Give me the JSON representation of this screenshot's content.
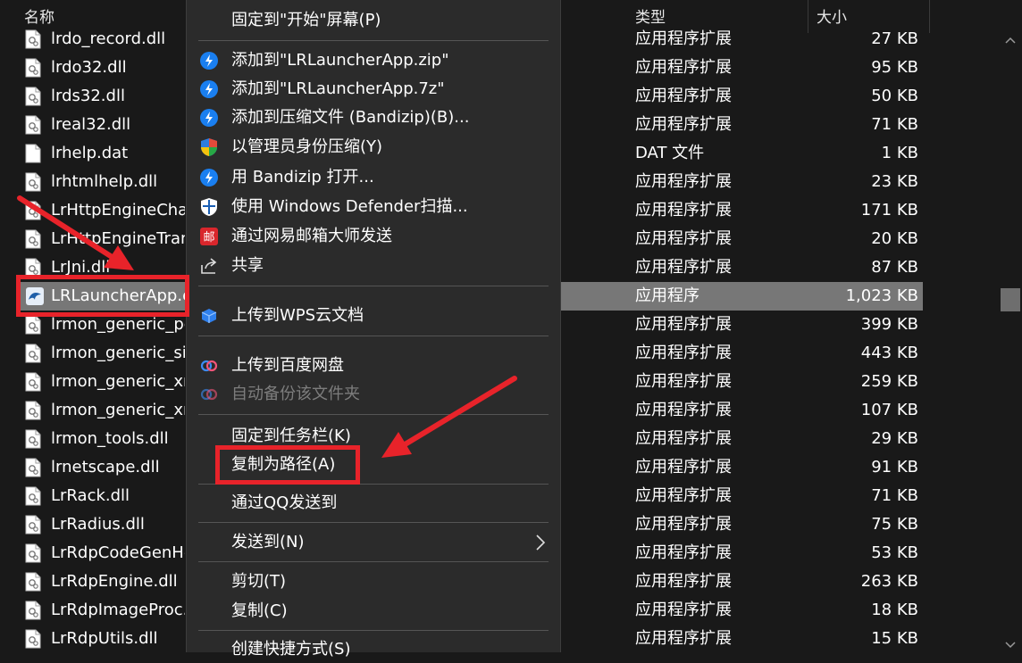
{
  "header": {
    "col_name": "名称",
    "col_type": "类型",
    "col_size": "大小"
  },
  "files": [
    {
      "name": "lrdo_record.dll",
      "type": "应用程序扩展",
      "size": "27 KB",
      "icon": "dll-icon"
    },
    {
      "name": "lrdo32.dll",
      "type": "应用程序扩展",
      "size": "95 KB",
      "icon": "dll-icon"
    },
    {
      "name": "lrds32.dll",
      "type": "应用程序扩展",
      "size": "50 KB",
      "icon": "dll-icon"
    },
    {
      "name": "lreal32.dll",
      "type": "应用程序扩展",
      "size": "71 KB",
      "icon": "dll-icon"
    },
    {
      "name": "lrhelp.dat",
      "type": "DAT 文件",
      "size": "1 KB",
      "icon": "file-icon"
    },
    {
      "name": "lrhtmlhelp.dll",
      "type": "应用程序扩展",
      "size": "23 KB",
      "icon": "dll-icon"
    },
    {
      "name": "LrHttpEngineChar",
      "type": "应用程序扩展",
      "size": "171 KB",
      "icon": "dll-icon"
    },
    {
      "name": "LrHttpEngineTran",
      "type": "应用程序扩展",
      "size": "20 KB",
      "icon": "dll-icon"
    },
    {
      "name": "LrJni.dll",
      "type": "应用程序扩展",
      "size": "87 KB",
      "icon": "dll-icon"
    },
    {
      "name": "LRLauncherApp.e",
      "type": "应用程序",
      "size": "1,023 KB",
      "icon": "app-icon",
      "selected": true
    },
    {
      "name": "lrmon_generic_pc",
      "type": "应用程序扩展",
      "size": "399 KB",
      "icon": "dll-icon"
    },
    {
      "name": "lrmon_generic_sit",
      "type": "应用程序扩展",
      "size": "443 KB",
      "icon": "dll-icon"
    },
    {
      "name": "lrmon_generic_xm",
      "type": "应用程序扩展",
      "size": "259 KB",
      "icon": "dll-icon"
    },
    {
      "name": "lrmon_generic_xm",
      "type": "应用程序扩展",
      "size": "107 KB",
      "icon": "dll-icon"
    },
    {
      "name": "lrmon_tools.dll",
      "type": "应用程序扩展",
      "size": "29 KB",
      "icon": "dll-icon"
    },
    {
      "name": "lrnetscape.dll",
      "type": "应用程序扩展",
      "size": "91 KB",
      "icon": "dll-icon"
    },
    {
      "name": "LrRack.dll",
      "type": "应用程序扩展",
      "size": "71 KB",
      "icon": "dll-icon"
    },
    {
      "name": "LrRadius.dll",
      "type": "应用程序扩展",
      "size": "75 KB",
      "icon": "dll-icon"
    },
    {
      "name": "LrRdpCodeGenHe",
      "type": "应用程序扩展",
      "size": "53 KB",
      "icon": "dll-icon"
    },
    {
      "name": "LrRdpEngine.dll",
      "type": "应用程序扩展",
      "size": "263 KB",
      "icon": "dll-icon"
    },
    {
      "name": "LrRdpImageProc.",
      "type": "应用程序扩展",
      "size": "18 KB",
      "icon": "dll-icon"
    },
    {
      "name": "LrRdpUtils.dll",
      "type": "应用程序扩展",
      "size": "15 KB",
      "icon": "dll-icon"
    }
  ],
  "menu": {
    "pin_start": "固定到\"开始\"屏幕(P)",
    "add_zip": "添加到\"LRLauncherApp.zip\"",
    "add_7z": "添加到\"LRLauncherApp.7z\"",
    "add_archive": "添加到压缩文件 (Bandizip)(B)...",
    "admin_compress": "以管理员身份压缩(Y)",
    "open_bandizip": "用 Bandizip 打开...",
    "defender_scan": "使用 Windows Defender扫描...",
    "netease_mail": "通过网易邮箱大师发送",
    "share": "共享",
    "upload_wps": "上传到WPS云文档",
    "upload_baidu": "上传到百度网盘",
    "auto_backup": "自动备份该文件夹",
    "pin_taskbar": "固定到任务栏(K)",
    "copy_path": "复制为路径(A)",
    "send_qq": "通过QQ发送到",
    "send_to": "发送到(N)",
    "cut": "剪切(T)",
    "copy": "复制(C)",
    "create_shortcut": "创建快捷方式(S)"
  },
  "colors": {
    "accent_red": "#e8232a",
    "selected_bg": "#777777",
    "menu_bg": "#2b2b2b",
    "bandizip_blue": "#1a7ff0"
  }
}
